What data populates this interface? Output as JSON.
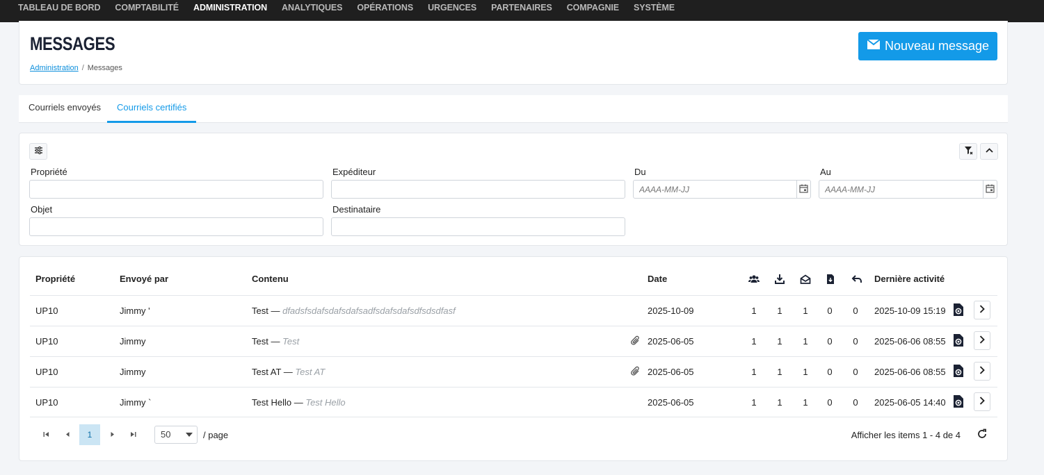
{
  "nav": {
    "items": [
      "TABLEAU DE BORD",
      "COMPTABILITÉ",
      "ADMINISTRATION",
      "ANALYTIQUES",
      "OPÉRATIONS",
      "URGENCES",
      "PARTENAIRES",
      "COMPAGNIE",
      "SYSTÈME"
    ],
    "active": "ADMINISTRATION"
  },
  "header": {
    "title": "MESSAGES",
    "breadcrumb_link": "Administration",
    "breadcrumb_sep": "/",
    "breadcrumb_current": "Messages",
    "new_button": "Nouveau message"
  },
  "tabs": [
    {
      "label": "Courriels envoyés"
    },
    {
      "label": "Courriels certifiés"
    }
  ],
  "active_tab": "Courriels certifiés",
  "filters": {
    "propriete_label": "Propriété",
    "expediteur_label": "Expéditeur",
    "du_label": "Du",
    "au_label": "Au",
    "objet_label": "Objet",
    "destinataire_label": "Destinataire",
    "date_placeholder": "AAAA-MM-JJ"
  },
  "table": {
    "headers": {
      "propriete": "Propriété",
      "envoye_par": "Envoyé par",
      "contenu": "Contenu",
      "date": "Date",
      "derniere_activite": "Dernière activité"
    },
    "header_icons": [
      "recipients-icon",
      "download-icon",
      "opened-icon",
      "document-download-icon",
      "reply-icon"
    ],
    "rows": [
      {
        "propriete": "UP10",
        "envoye_par": "Jimmy '",
        "objet": "Test —",
        "apercu": "dfadsfsdafsdafsdafsadfsdafsdafsdfsdsdfasf",
        "attachment": false,
        "date": "2025-10-09",
        "n1": "1",
        "n2": "1",
        "n3": "1",
        "n4": "0",
        "n5": "0",
        "derniere_activite": "2025-10-09 15:19"
      },
      {
        "propriete": "UP10",
        "envoye_par": "Jimmy",
        "objet": "Test —",
        "apercu": "Test",
        "attachment": true,
        "date": "2025-06-05",
        "n1": "1",
        "n2": "1",
        "n3": "1",
        "n4": "0",
        "n5": "0",
        "derniere_activite": "2025-06-06 08:55"
      },
      {
        "propriete": "UP10",
        "envoye_par": "Jimmy",
        "objet": "Test AT —",
        "apercu": "Test AT",
        "attachment": true,
        "date": "2025-06-05",
        "n1": "1",
        "n2": "1",
        "n3": "1",
        "n4": "0",
        "n5": "0",
        "derniere_activite": "2025-06-06 08:55"
      },
      {
        "propriete": "UP10",
        "envoye_par": "Jimmy `",
        "objet": "Test Hello —",
        "apercu": "Test Hello",
        "attachment": false,
        "date": "2025-06-05",
        "n1": "1",
        "n2": "1",
        "n3": "1",
        "n4": "0",
        "n5": "0",
        "derniere_activite": "2025-06-05 14:40"
      }
    ]
  },
  "pager": {
    "current_page": "1",
    "page_size": "50",
    "per_page_label": "/ page",
    "items_info": "Afficher les items 1 - 4 de 4"
  },
  "colors": {
    "accent": "#139ae8",
    "nav_bg": "#1f1f1f"
  }
}
